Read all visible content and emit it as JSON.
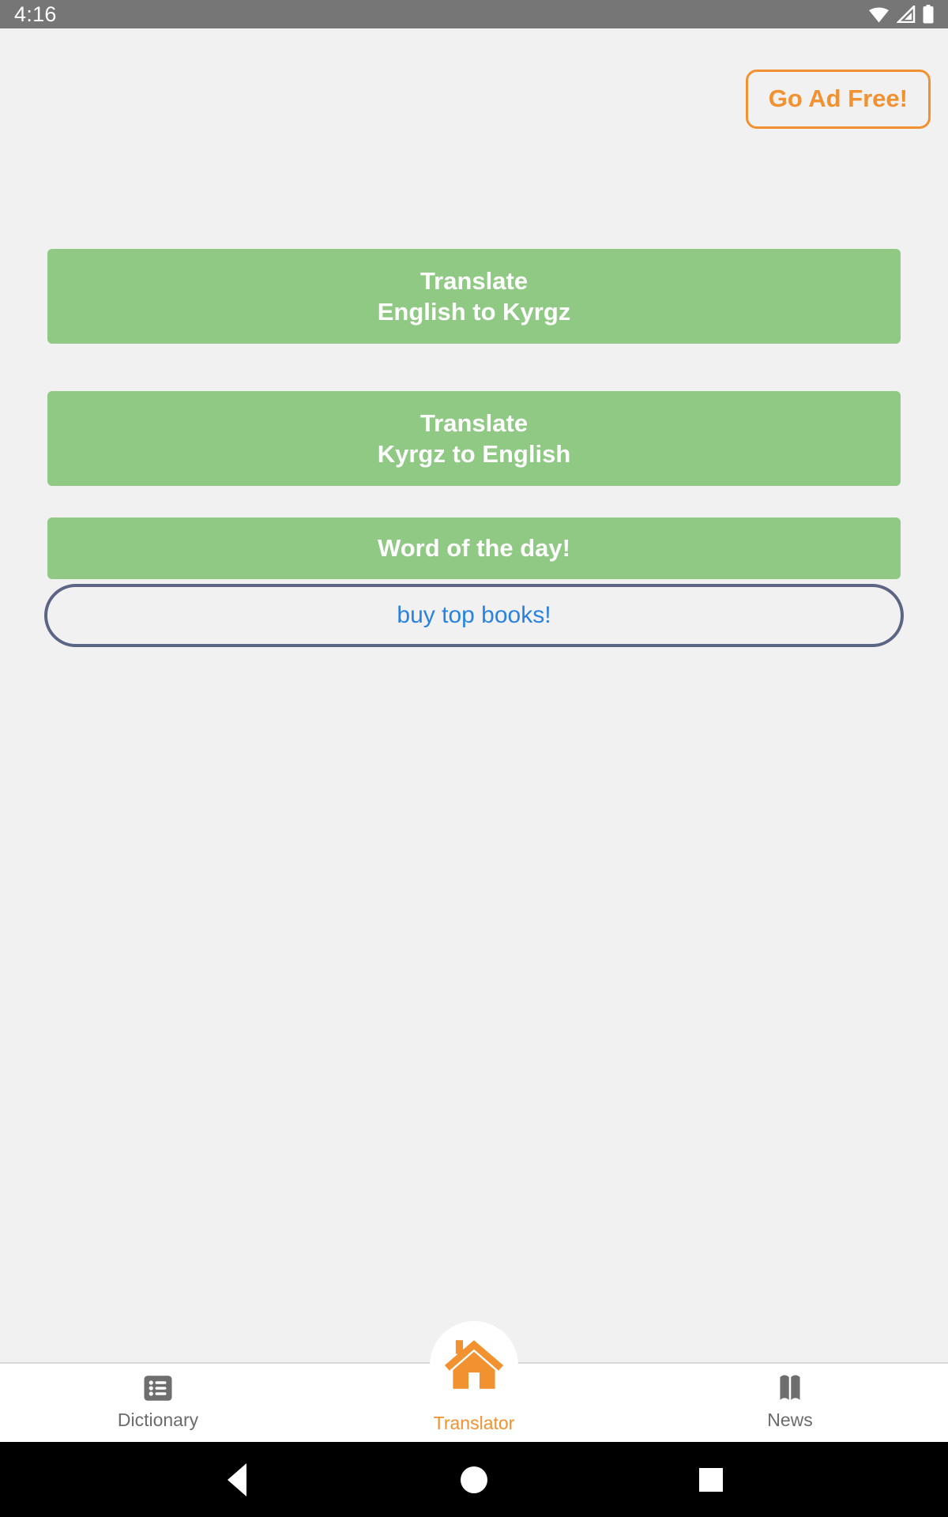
{
  "status_bar": {
    "time": "4:16",
    "icons": [
      "wifi-icon",
      "signal-icon",
      "battery-icon"
    ],
    "background_color": "#767676"
  },
  "header": {
    "ad_free_label": "Go Ad Free!",
    "ad_free_color": "#f2912f"
  },
  "main": {
    "background_color": "#f1f1f1",
    "buttons": [
      {
        "name": "translate-english-to-kyrgz",
        "line1": "Translate",
        "line2": "English to Kyrgz",
        "style": "green",
        "color": "#8fc984"
      },
      {
        "name": "translate-kyrgz-to-english",
        "line1": "Translate",
        "line2": "Kyrgz to English",
        "style": "green",
        "color": "#8fc984"
      },
      {
        "name": "word-of-the-day",
        "line1": "Word of the day!",
        "style": "green",
        "color": "#8fc984"
      }
    ],
    "books_button": {
      "label": "buy top books!",
      "text_color": "#2a82e0",
      "border_color": "#5d6585"
    }
  },
  "tabbar": {
    "active": "Translator",
    "accent_color": "#f2912f",
    "inactive_color": "#6b6b6b",
    "items": [
      {
        "label": "Dictionary",
        "icon": "list-icon",
        "active": false
      },
      {
        "label": "Translator",
        "icon": "home-icon",
        "active": true
      },
      {
        "label": "News",
        "icon": "book-icon",
        "active": false
      }
    ]
  },
  "system_nav": {
    "buttons": [
      "back-button",
      "home-button",
      "recents-button"
    ]
  }
}
